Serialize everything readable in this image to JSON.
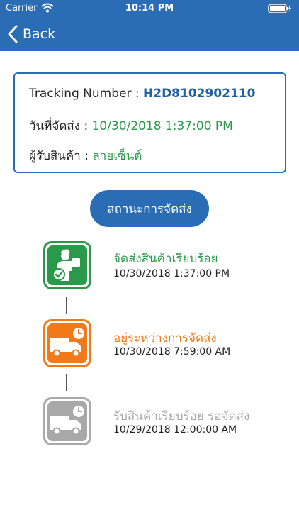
{
  "status_bar": {
    "carrier": "Carrier",
    "time": "10:14 PM"
  },
  "nav": {
    "back_label": "Back"
  },
  "tracking": {
    "number_label": "Tracking Number :",
    "number_value": "H2D8102902110",
    "date_label": "วันที่จัดส่ง :",
    "date_value": "10/30/2018 1:37:00 PM",
    "receiver_label": "ผู้รับสินค้า :",
    "receiver_value": "ลายเซ็นต์"
  },
  "status_button": {
    "label": "สถานะการจัดส่ง"
  },
  "steps": [
    {
      "title": "จัดส่งสินค้าเรียบร้อย",
      "date": "10/30/2018 1:37:00 PM",
      "color": "#2a9a4a",
      "icon": "delivered-person-icon"
    },
    {
      "title": "อยู่ระหว่างการจัดส่ง",
      "date": "10/30/2018 7:59:00 AM",
      "color": "#f07a1a",
      "icon": "truck-clock-icon"
    },
    {
      "title": "รับสินค้าเรียบร้อย รอจัดส่ง",
      "date": "10/29/2018 12:00:00 AM",
      "color": "#a8a8a8",
      "icon": "truck-clock-icon"
    }
  ]
}
